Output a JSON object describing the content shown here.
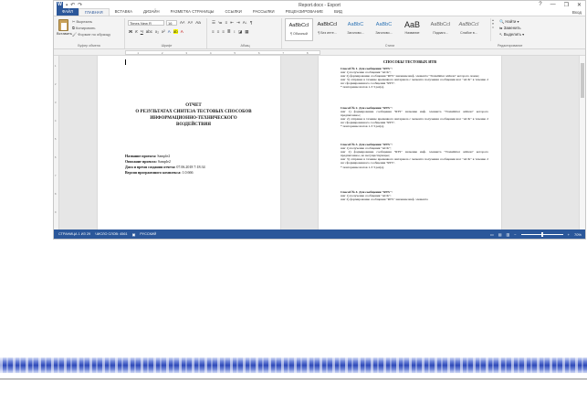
{
  "window": {
    "title": "Report.docx - Export",
    "controls": [
      "?",
      "—",
      "❐",
      "✕"
    ],
    "signin": "Вход"
  },
  "tabs": [
    "ФАЙЛ",
    "ГЛАВНАЯ",
    "ВСТАВКА",
    "ДИЗАЙН",
    "РАЗМЕТКА СТРАНИЦЫ",
    "ССЫЛКИ",
    "РАССЫЛКИ",
    "РЕЦЕНЗИРОВАНИЕ",
    "ВИД"
  ],
  "ribbon": {
    "paste": "Вставить",
    "cut": "Вырезать",
    "copy": "Копировать",
    "format_painter": "Формат по образцу",
    "clipboard_label": "Буфер обмена",
    "font_name": "Times New R",
    "font_size": "16",
    "font_label": "Шрифт",
    "paragraph_label": "Абзац",
    "styles_label": "Стили",
    "find": "Найти",
    "replace": "Заменить",
    "select": "Выделить",
    "editing_label": "Редактирование",
    "styles": [
      {
        "sample": "AaBbCcI",
        "name": "¶ Обычный"
      },
      {
        "sample": "AaBbCcI",
        "name": "¶ Без инте..."
      },
      {
        "sample": "AaBbC",
        "name": "Заголово..."
      },
      {
        "sample": "AaBbC",
        "name": "Заголово..."
      },
      {
        "sample": "AaB",
        "name": "Название"
      },
      {
        "sample": "AaBbCcI",
        "name": "Подзаго..."
      },
      {
        "sample": "AaBbCcI",
        "name": "Слабое в..."
      }
    ]
  },
  "page1": {
    "title_lines": [
      "ОТЧЕТ",
      "О РЕЗУЛЬТАТАХ СИНТЕЗА ТЕСТОВЫХ СПОСОБОВ",
      "ИНФОРМАЦИОННО-ТЕХНИЧЕСКОГО",
      "ВОЗДЕЙСТВИЯ"
    ],
    "meta": [
      {
        "label": "Название проекта:",
        "value": " Sample2"
      },
      {
        "label": "Описание проекта:",
        "value": " Sample2"
      },
      {
        "label": "Дата и время создания отчета:",
        "value": " 07.06.2018 7:18:34"
      },
      {
        "label": "Версия программного комплекса:",
        "value": " 1.0.666"
      }
    ]
  },
  "page2": {
    "heading": "СПОСОБЫ ТЕСТОВЫХ ИТВ",
    "blocks": [
      {
        "lines": [
          "Способ № 1. Для сообщения \"RTS\":",
          "шаг 1) получение сообщения \"ACK\";",
          "шаг 2) формирование сообщения \"RTS\" значение инф. элемента \"Transmitter address\" которого ложно;",
          "шаг 3) отправка в течение временного интервала с момента получения сообщения шаг \"ACK\" в течение 2 шс сформированного сообщения \"RTS\".",
          "* повторение шагов 1-3 3 раз(а)."
        ]
      },
      {
        "lines": [
          "Способ № 2. Для сообщения \"RTS\":",
          "шаг 1) формирование сообщения \"RTS\" значение инф. элемента \"Transmitter address\" которого предписанное;",
          "шаг 2) отправка в течение временного интервала с момента получения сообщения шаг \"ACK\" в течение 2 шс сформированного сообщения \"RTS\".",
          "* повторение шагов 1-3 3 раз(а)."
        ]
      },
      {
        "lines": [
          "Способ № 3. Для сообщения \"RTS\":",
          "шаг 1) получение сообщения \"ACK\";",
          "шаг 2) формирование сообщения \"RTS\" значение инф. элемента \"Transmitter address\" которого предписанное, но несуществующее;",
          "шаг 3) отправка в течение временного интервала с момента получения сообщения шаг \"ACK\" в течение 2 шс сформированного сообщения \"RTS\".",
          "* повторение шагов 1-3 3 раз(а)."
        ]
      },
      {
        "lines": [
          "Способ № 4. Для сообщения \"RTS\":",
          "шаг 1) получение сообщения \"ACK\";",
          "шаг 2) формирование сообщения \"RTS\" значение инф. элемента"
        ]
      }
    ]
  },
  "status": {
    "page": "СТРАНИЦА 1 ИЗ 29",
    "words": "ЧИСЛО СЛОВ: 4561",
    "lang": "РУССКИЙ",
    "zoom": "70%"
  }
}
